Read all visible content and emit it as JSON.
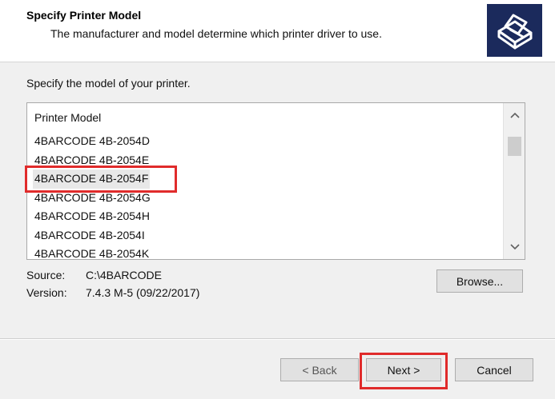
{
  "header": {
    "title": "Specify Printer Model",
    "subtitle": "The manufacturer and model determine which printer driver to use.",
    "icon": "printer-icon"
  },
  "instruction": "Specify the model of your printer.",
  "list": {
    "header": "Printer Model",
    "items": [
      "4BARCODE 4B-2054D",
      "4BARCODE 4B-2054E",
      "4BARCODE 4B-2054F",
      "4BARCODE 4B-2054G",
      "4BARCODE 4B-2054H",
      "4BARCODE 4B-2054I",
      "4BARCODE 4B-2054K"
    ],
    "selected_index": 2
  },
  "info": {
    "source_label": "Source:",
    "source_value": "C:\\4BARCODE",
    "version_label": "Version:",
    "version_value": "7.4.3 M-5 (09/22/2017)"
  },
  "buttons": {
    "browse": "Browse...",
    "back": "< Back",
    "next": "Next >",
    "cancel": "Cancel"
  },
  "colors": {
    "highlight": "#e02b2b",
    "icon_bg": "#1b2a5c"
  }
}
